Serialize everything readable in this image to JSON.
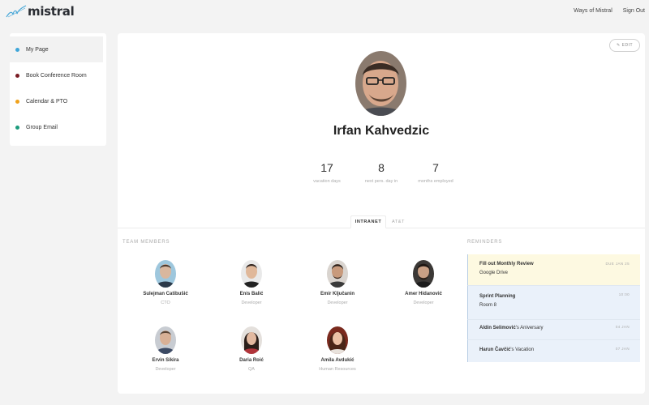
{
  "app": {
    "logo_text": "mistral"
  },
  "header": {
    "links": [
      "Ways of Mistral",
      "Sign Out"
    ]
  },
  "sidebar": {
    "items": [
      {
        "label": "My Page",
        "color": "#3fa6d9"
      },
      {
        "label": "Book Conference Room",
        "color": "#7a1c24"
      },
      {
        "label": "Calendar & PTO",
        "color": "#f0a21c"
      },
      {
        "label": "Group Email",
        "color": "#1c9b7d"
      }
    ]
  },
  "profile": {
    "edit_label": "EDIT",
    "name": "Irfan Kahvedzic",
    "stats": [
      {
        "value": "17",
        "label": "vacation days"
      },
      {
        "value": "8",
        "label": "next pers. day in"
      },
      {
        "value": "7",
        "label": "months employed"
      }
    ]
  },
  "tabs": [
    "INTRANET",
    "AT&T"
  ],
  "team": {
    "title": "TEAM MEMBERS",
    "members": [
      {
        "name": "Sulejman Catibušić",
        "role": "CTO"
      },
      {
        "name": "Enis Balić",
        "role": "Developer"
      },
      {
        "name": "Emir Ključanin",
        "role": "Developer"
      },
      {
        "name": "Amer Hidanović",
        "role": "Developer"
      },
      {
        "name": "Ervin Sikira",
        "role": "Developer"
      },
      {
        "name": "Daria Roić",
        "role": "QA"
      },
      {
        "name": "Amila Avdukić",
        "role": "Human Resources"
      }
    ]
  },
  "reminders": {
    "title": "REMINDERS",
    "items": [
      {
        "title": "Fill out Monthly Review",
        "subtitle": "Google Drive",
        "date": "DUE JAN 25",
        "bg": "#fdf9e1"
      },
      {
        "title": "Sprint Planning",
        "subtitle": "Room 8",
        "date": "10:00",
        "bg": "#eaf1fa"
      },
      {
        "name": "Aldin Selimović",
        "suffix": "'s Aniversary",
        "date": "04 JAN",
        "bg": "#eaf1fa"
      },
      {
        "name": "Harun Čavčić",
        "suffix": "'s Vacation",
        "date": "07 JAN",
        "bg": "#eaf1fa"
      }
    ]
  },
  "colors": {
    "accent": "#3fa6d9",
    "reminder_border": "#b7cde4"
  }
}
